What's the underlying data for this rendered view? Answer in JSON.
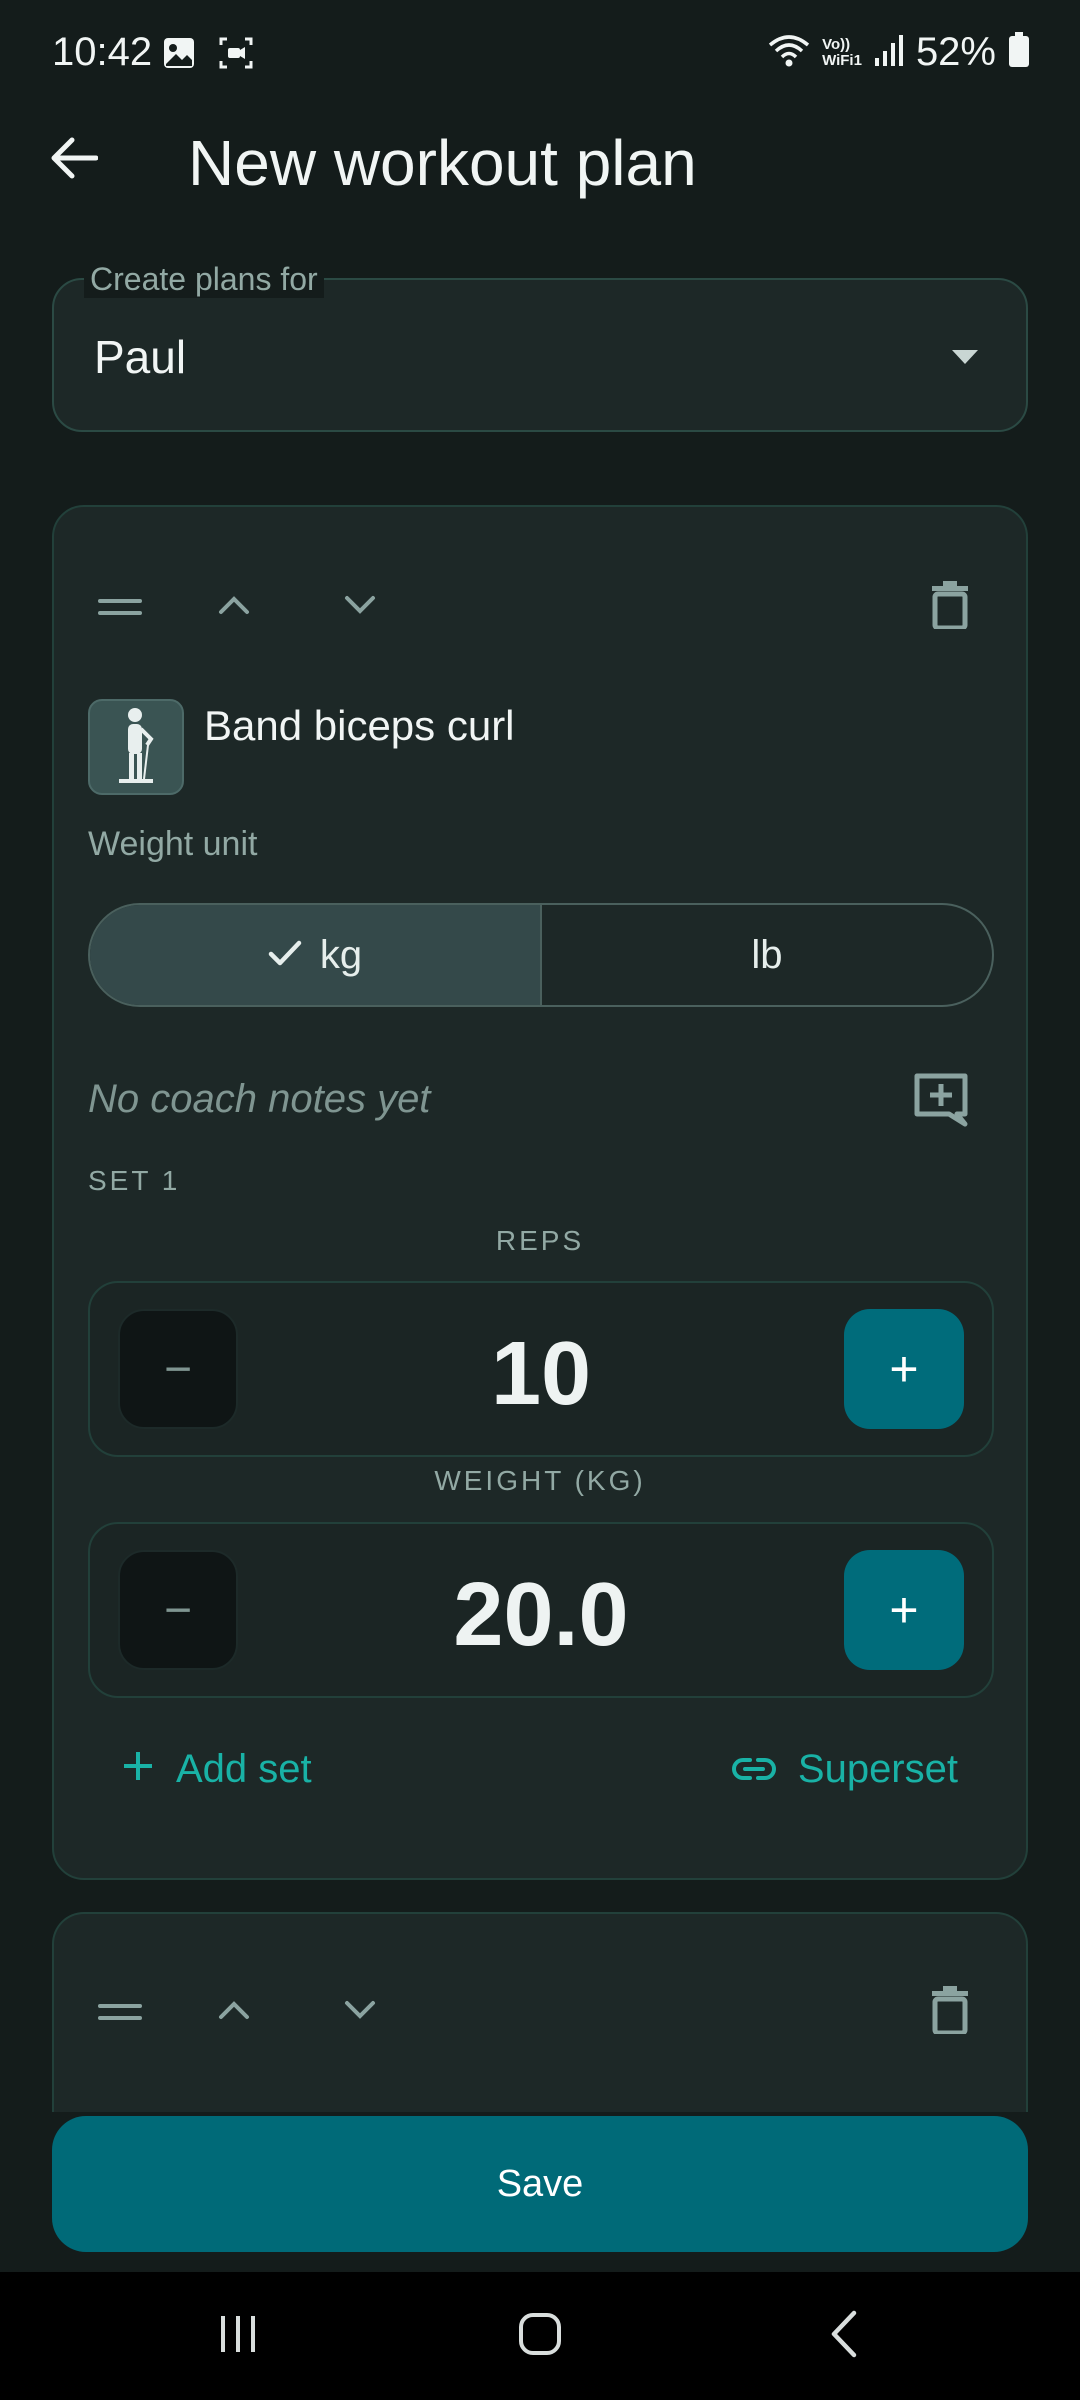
{
  "status_bar": {
    "time": "10:42",
    "volte_line1": "Vo))",
    "volte_line2": "WiFi1",
    "battery": "52%"
  },
  "header": {
    "title": "New workout plan",
    "back_icon": "arrow-left-icon"
  },
  "plan_for": {
    "label": "Create plans for",
    "value": "Paul"
  },
  "exercise": {
    "name": "Band biceps curl",
    "weight_unit_label": "Weight unit",
    "units": [
      {
        "label": "kg",
        "selected": true
      },
      {
        "label": "lb",
        "selected": false
      }
    ],
    "coach_notes": "No coach notes yet",
    "set_label": "SET 1",
    "reps_caption": "REPS",
    "reps_value": "10",
    "weight_caption": "WEIGHT (KG)",
    "weight_value": "20.0",
    "minus": "−",
    "plus": "+",
    "add_set": "Add set",
    "superset": "Superset"
  },
  "save_label": "Save",
  "colors": {
    "background": "#141c1b",
    "card": "#1d2827",
    "accent": "#006a78",
    "link": "#19b2a6"
  }
}
